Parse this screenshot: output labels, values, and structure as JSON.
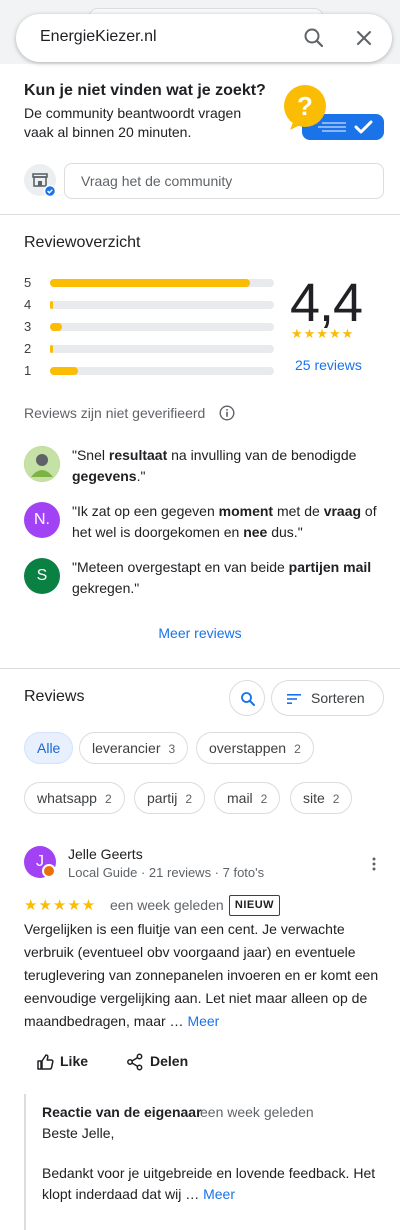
{
  "search": {
    "value": "EnergieKiezer.nl"
  },
  "community": {
    "title": "Kun je niet vinden wat je zoekt?",
    "subtitle": "De community beantwoordt vragen vaak al binnen 20 minuten.",
    "input_placeholder": "Vraag het de community"
  },
  "overview": {
    "title": "Reviewoverzicht",
    "bars": [
      {
        "label": "5",
        "fraction": 1.0
      },
      {
        "label": "4",
        "fraction": 0.01
      },
      {
        "label": "3",
        "fraction": 0.06
      },
      {
        "label": "2",
        "fraction": 0.01
      },
      {
        "label": "1",
        "fraction": 0.14
      }
    ],
    "score": "4,4",
    "stars": "★★★★★",
    "reviews_link": "25 reviews",
    "not_verified": "Reviews zijn niet geverifieerd"
  },
  "snippets": [
    {
      "avatar": "",
      "avatar_color": "#7cb342",
      "parts": [
        [
          "\"Snel ",
          false
        ],
        [
          "resultaat",
          true
        ],
        [
          " na invulling van de benodigde ",
          false
        ],
        [
          "gegevens",
          true
        ],
        [
          ".\"",
          false
        ]
      ]
    },
    {
      "avatar": "N.",
      "avatar_color": "#a142f4",
      "parts": [
        [
          "\"Ik zat op een gegeven ",
          false
        ],
        [
          "moment",
          true
        ],
        [
          " met de ",
          false
        ],
        [
          "vraag",
          true
        ],
        [
          " of het wel is doorgekomen en ",
          false
        ],
        [
          "nee",
          true
        ],
        [
          " dus.\"",
          false
        ]
      ]
    },
    {
      "avatar": "S",
      "avatar_color": "#0b8043",
      "parts": [
        [
          "\"Meteen overgestapt en van beide ",
          false
        ],
        [
          "partijen mail",
          true
        ],
        [
          " gekregen.\"",
          false
        ]
      ]
    }
  ],
  "more_reviews": "Meer reviews",
  "reviews": {
    "title": "Reviews",
    "sort_label": "Sorteren",
    "chips": [
      {
        "label": "Alle",
        "count": ""
      },
      {
        "label": "leverancier",
        "count": "3"
      },
      {
        "label": "overstappen",
        "count": "2"
      },
      {
        "label": "whatsapp",
        "count": "2"
      },
      {
        "label": "partij",
        "count": "2"
      },
      {
        "label": "mail",
        "count": "2"
      },
      {
        "label": "site",
        "count": "2"
      }
    ]
  },
  "review": {
    "avatar": "J",
    "name": "Jelle Geerts",
    "meta": "Local Guide · 21 reviews · 7 foto's",
    "stars": "★★★★★",
    "date": "een week geleden",
    "badge": "NIEUW",
    "text": "Vergelijken is een fluitje van een cent. Je verwachte verbruik (eventueel obv voorgaand jaar) en eventuele teruglevering van zonnepanelen invoeren en er komt een eenvoudige vergelijking aan. Let niet maar alleen op de maandbedragen, maar … ",
    "more": "Meer",
    "like": "Like",
    "share": "Delen"
  },
  "owner": {
    "title": "Reactie van de eigenaar",
    "date": "een week geleden",
    "greeting": "Beste Jelle,",
    "text": "Bedankt voor je uitgebreide en lovende feedback. Het klopt inderdaad dat wij … ",
    "more": "Meer"
  },
  "colors": {
    "accent": "#1a73e8",
    "star": "#fbbc04",
    "chip_active_bg": "#e8f0fe"
  }
}
